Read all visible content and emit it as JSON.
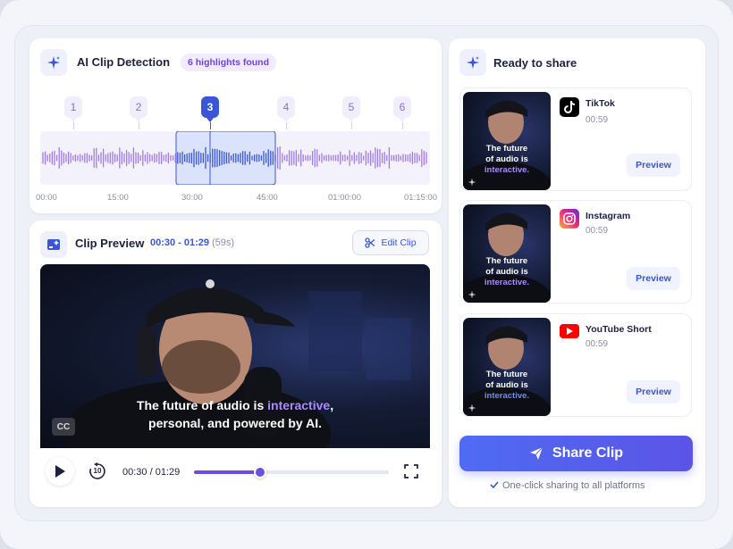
{
  "detection": {
    "title": "AI Clip Detection",
    "badge": "6 highlights found",
    "markers": [
      "1",
      "2",
      "3",
      "4",
      "5",
      "6"
    ],
    "active_marker": "3",
    "timeline_ticks": [
      "00:00",
      "15:00",
      "30:00",
      "45:00",
      "01:00:00",
      "01:15:00"
    ]
  },
  "preview": {
    "title": "Clip Preview",
    "range": "00:30 - 01:29",
    "duration": "(59s)",
    "edit_label": "Edit Clip",
    "caption_pre": "The future of audio is ",
    "caption_highlight": "interactive",
    "caption_post": ",",
    "caption_line2": "personal, and powered by AI.",
    "cc_label": "CC",
    "skip_label": "10",
    "time_display": "00:30 / 01:29",
    "progress": 0.34
  },
  "share": {
    "title": "Ready to share",
    "thumb_line1": "The future",
    "thumb_line2": "of audio is",
    "thumb_line3": "interactive.",
    "platforms": [
      {
        "name": "TikTok",
        "duration": "00:59",
        "preview": "Preview"
      },
      {
        "name": "Instagram",
        "duration": "00:59",
        "preview": "Preview"
      },
      {
        "name": "YouTube Short",
        "duration": "00:59",
        "preview": "Preview"
      }
    ],
    "share_button": "Share Clip",
    "footer": "One-click sharing to all platforms"
  },
  "colors": {
    "accent": "#3a56d8",
    "purple": "#8a5fe0",
    "highlight": "#a98bff"
  }
}
